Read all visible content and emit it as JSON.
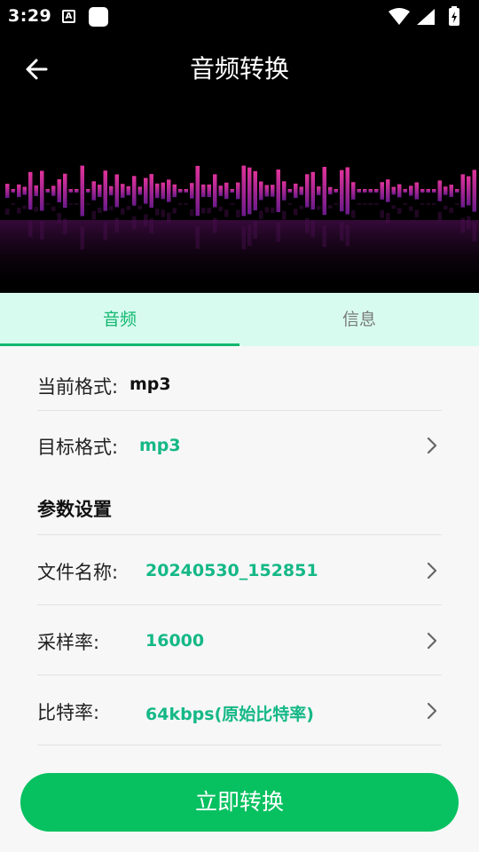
{
  "status_bar": {
    "time": "3:29",
    "notif_letter": "A"
  },
  "header": {
    "title": "音频转换",
    "back_icon": "arrow-left-icon"
  },
  "tabs": [
    {
      "label": "音频",
      "active": true
    },
    {
      "label": "信息",
      "active": false
    }
  ],
  "current_format": {
    "label": "当前格式:",
    "value": "mp3"
  },
  "target_format": {
    "label": "目标格式:",
    "value": "mp3"
  },
  "section": {
    "title": "参数设置"
  },
  "params": [
    {
      "label": "文件名称:",
      "value": "20240530_152851"
    },
    {
      "label": "采样率:",
      "value": "16000"
    },
    {
      "label": "比特率:",
      "value": "64kbps(原始比特率)"
    }
  ],
  "action": {
    "label": "立即转换"
  },
  "colors": {
    "accent": "#11b76f",
    "value_green": "#14b886",
    "button_green": "#07c160",
    "tab_bg": "#d7fbef",
    "wave_top": "#e0339a",
    "wave_bottom": "#6a1a8a"
  }
}
